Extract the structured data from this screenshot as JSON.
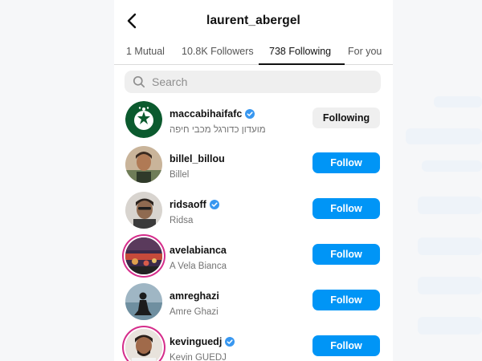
{
  "header": {
    "username": "laurent_abergel"
  },
  "tabs": [
    {
      "label": "1 Mutual"
    },
    {
      "label": "10.8K Followers"
    },
    {
      "label": "738 Following",
      "active": true
    },
    {
      "label": "For you"
    }
  ],
  "search": {
    "placeholder": "Search",
    "value": ""
  },
  "accounts": [
    {
      "handle": "maccabihaifafc",
      "name": "מועדון כדורגל מכבי חיפה",
      "verified": true,
      "button": "Following",
      "story_ring": false
    },
    {
      "handle": "billel_billou",
      "name": "Billel",
      "verified": false,
      "button": "Follow",
      "story_ring": false
    },
    {
      "handle": "ridsaoff",
      "name": "Ridsa",
      "verified": true,
      "button": "Follow",
      "story_ring": false
    },
    {
      "handle": "avelabianca",
      "name": "A Vela Bianca",
      "verified": false,
      "button": "Follow",
      "story_ring": true
    },
    {
      "handle": "amreghazi",
      "name": "Amre Ghazi",
      "verified": false,
      "button": "Follow",
      "story_ring": false
    },
    {
      "handle": "kevinguedj",
      "name": "Kevin GUEDJ",
      "verified": true,
      "button": "Follow",
      "story_ring": true
    }
  ],
  "colors": {
    "follow_blue": "#0095f6",
    "verified_blue": "#3897f0",
    "story_ring": "#d52d8b",
    "maccabi_green": "#0b5a2e"
  },
  "icons": {
    "back": "chevron-left-icon",
    "search": "search-icon",
    "verified": "verified-badge-icon"
  }
}
